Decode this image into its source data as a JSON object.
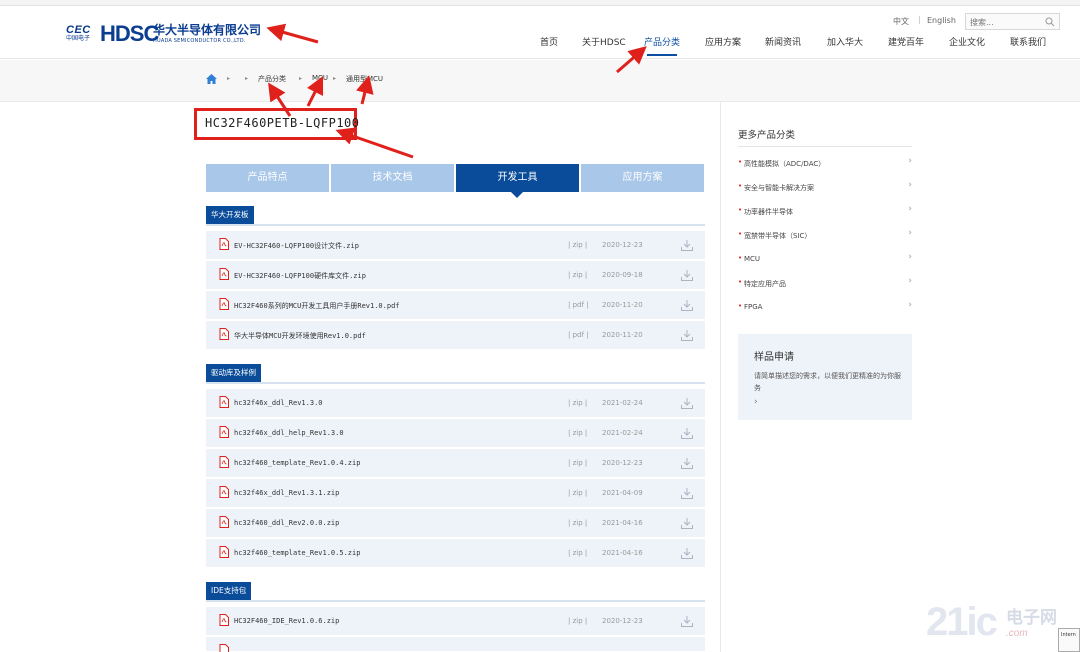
{
  "header": {
    "logo_cec": "CEC",
    "logo_cec_sub": "中国电子",
    "logo_hdsc": "HDSC",
    "company_cn": "华大半导体有限公司",
    "company_en": "HUADA SEMICONDUCTOR CO.,LTD.",
    "lang_cn": "中文",
    "lang_sep": "|",
    "lang_en": "English",
    "search_placeholder": "搜索...",
    "nav": [
      "首页",
      "关于HDSC",
      "产品分类",
      "应用方案",
      "新闻资讯",
      "加入华大",
      "建党百年",
      "企业文化",
      "联系我们"
    ],
    "active_nav": "产品分类"
  },
  "breadcrumb": {
    "items": [
      "产品分类",
      "MCU",
      "通用型MCU"
    ]
  },
  "product": {
    "title": "HC32F460PETB-LQFP100"
  },
  "tabs": {
    "items": [
      "产品特点",
      "技术文档",
      "开发工具",
      "应用方案"
    ],
    "active": "开发工具"
  },
  "sections": [
    {
      "name": "华大开发板",
      "files": [
        {
          "name": "EV-HC32F460-LQFP100设计文件.zip",
          "type": "| zip |",
          "date": "2020-12-23"
        },
        {
          "name": "EV-HC32F460-LQFP100硬件库文件.zip",
          "type": "| zip |",
          "date": "2020-09-18"
        },
        {
          "name": "HC32F460系列的MCU开发工具用户手册Rev1.0.pdf",
          "type": "| pdf |",
          "date": "2020-11-20"
        },
        {
          "name": "华大半导体MCU开发环境使用Rev1.0.pdf",
          "type": "| pdf |",
          "date": "2020-11-20"
        }
      ]
    },
    {
      "name": "驱动库及样例",
      "files": [
        {
          "name": "hc32f46x_ddl_Rev1.3.0",
          "type": "| zip |",
          "date": "2021-02-24"
        },
        {
          "name": "hc32f46x_ddl_help_Rev1.3.0",
          "type": "| zip |",
          "date": "2021-02-24"
        },
        {
          "name": "hc32f460_template_Rev1.0.4.zip",
          "type": "| zip |",
          "date": "2020-12-23"
        },
        {
          "name": "hc32f46x_ddl_Rev1.3.1.zip",
          "type": "| zip |",
          "date": "2021-04-09"
        },
        {
          "name": "hc32f460_ddl_Rev2.0.0.zip",
          "type": "| zip |",
          "date": "2021-04-16"
        },
        {
          "name": "hc32f460_template_Rev1.0.5.zip",
          "type": "| zip |",
          "date": "2021-04-16"
        }
      ]
    },
    {
      "name": "IDE支持包",
      "files": [
        {
          "name": "HC32F460_IDE_Rev1.0.6.zip",
          "type": "| zip |",
          "date": "2020-12-23"
        }
      ]
    }
  ],
  "sidebar": {
    "title": "更多产品分类",
    "items": [
      "高性能模拟（ADC/DAC）",
      "安全与智能卡解决方案",
      "功率器件半导体",
      "宽禁带半导体（SIC）",
      "MCU",
      "特定应用产品",
      "FPGA"
    ],
    "sample": {
      "title": "样品申请",
      "desc": "请简单描述您的需求，以便我们更精准的为你服务",
      "arrow": "›"
    }
  },
  "watermark": {
    "brand": "21ic",
    "cn": "电子网",
    "sub": ".com",
    "corner": "Intern"
  },
  "colors": {
    "brand_blue": "#0a4c9a",
    "tab_inactive": "#a9c7e8",
    "row_bg": "#eef3f9",
    "annotation_red": "#e0211b"
  }
}
